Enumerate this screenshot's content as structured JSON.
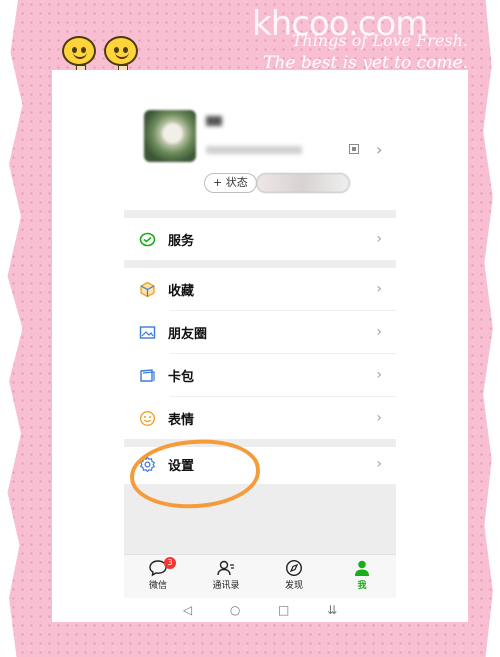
{
  "watermark": "khcoo.com",
  "decoration": {
    "script_line1": "Things of Love Fresh.",
    "script_line2": "The best is yet to come."
  },
  "profile": {
    "status_label": "+ 状态"
  },
  "menu": {
    "items": [
      {
        "label": "服务",
        "icon": "service-icon"
      },
      {
        "label": "收藏",
        "icon": "favorites-icon"
      },
      {
        "label": "朋友圈",
        "icon": "moments-icon"
      },
      {
        "label": "卡包",
        "icon": "card-wallet-icon"
      },
      {
        "label": "表情",
        "icon": "sticker-icon"
      },
      {
        "label": "设置",
        "icon": "settings-icon"
      }
    ]
  },
  "tabbar": {
    "tabs": [
      {
        "label": "微信",
        "icon": "chat-icon",
        "badge": "3"
      },
      {
        "label": "通讯录",
        "icon": "contacts-icon"
      },
      {
        "label": "发现",
        "icon": "compass-icon"
      },
      {
        "label": "我",
        "icon": "person-icon",
        "active": true
      }
    ]
  },
  "navbar": {
    "back": "◁",
    "home": "○",
    "recent": "□",
    "menu": "⇊"
  },
  "colors": {
    "accent": "#1aad19",
    "badge": "#f43530",
    "highlight_ring": "#f59b3a",
    "frame_pink": "#f7bfd1"
  }
}
